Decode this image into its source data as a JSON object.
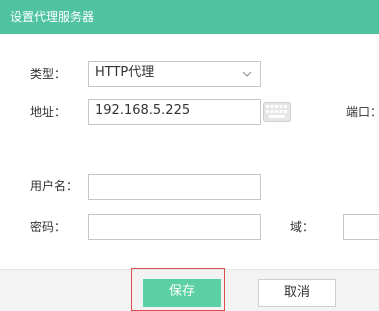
{
  "dialog": {
    "title": "设置代理服务器"
  },
  "form": {
    "type_label": "类型：",
    "type_value": "HTTP代理",
    "address_label": "地址：",
    "address_value": "192.168.5.225",
    "port_label": "端口：",
    "username_label": "用户名：",
    "username_value": "",
    "password_label": "密码：",
    "password_value": "",
    "domain_label": "域：",
    "domain_value": ""
  },
  "buttons": {
    "save": "保存",
    "cancel": "取消"
  },
  "colors": {
    "titlebar": "#4fc39f",
    "save_button": "#5bd0a5",
    "highlight_border": "#e04b4b"
  },
  "icons": {
    "dropdown": "chevron-down-icon",
    "keyboard": "keyboard-icon"
  }
}
